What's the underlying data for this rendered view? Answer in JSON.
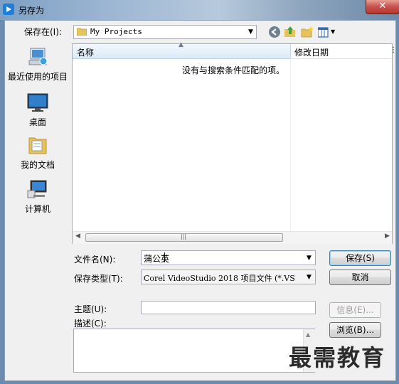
{
  "window": {
    "title": "另存为",
    "close_glyph": "✕"
  },
  "savein": {
    "label": "保存在(I):",
    "value": "My Projects"
  },
  "places": [
    {
      "label": "最近使用的项目",
      "icon": "recent-places-icon"
    },
    {
      "label": "桌面",
      "icon": "desktop-icon"
    },
    {
      "label": "我的文档",
      "icon": "documents-icon"
    },
    {
      "label": "计算机",
      "icon": "computer-icon"
    }
  ],
  "filelist": {
    "columns": [
      "名称",
      "修改日期"
    ],
    "empty_message": "没有与搜索条件匹配的项。"
  },
  "form": {
    "filename_label": "文件名(N):",
    "filename_value": "蒲公英",
    "filetype_label": "保存类型(T):",
    "filetype_value": "Corel VideoStudio 2018 项目文件 (*.VS",
    "subject_label": "主题(U):",
    "subject_value": "",
    "description_label": "描述(C):"
  },
  "buttons": {
    "save": "保存(S)",
    "cancel": "取消",
    "info": "信息(E)...",
    "browse": "浏览(B)..."
  },
  "watermark": "最需教育",
  "colors": {
    "accent": "#3c7fb1",
    "titlebar": "#9fb8d4"
  }
}
